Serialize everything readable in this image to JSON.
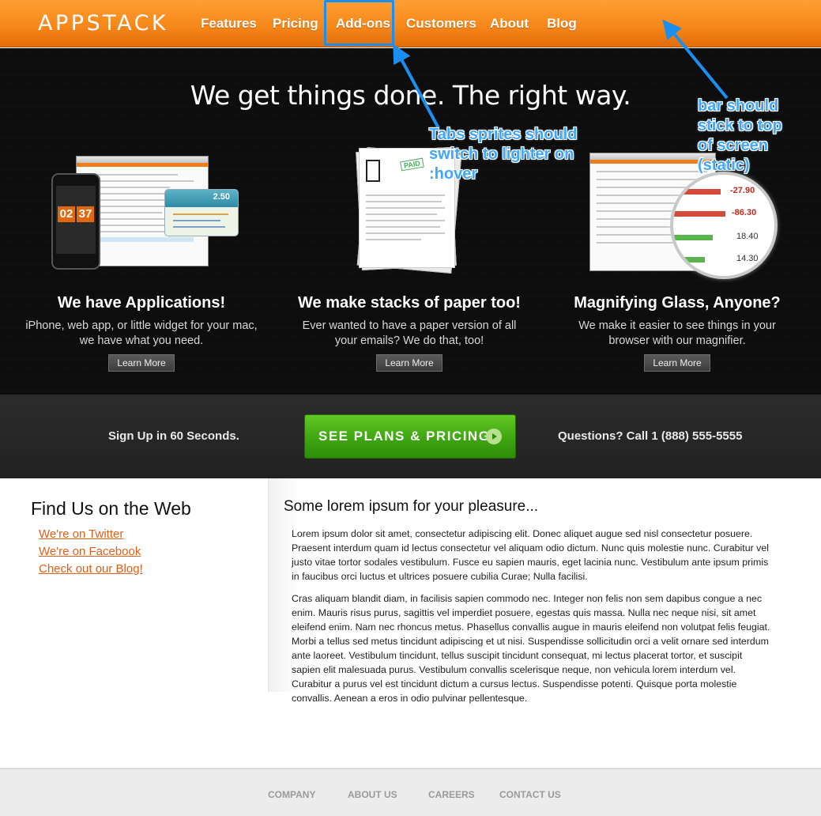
{
  "brand": {
    "logo": "APPSTACK",
    "accent": "#f7881a",
    "cta_green": "#3fa512"
  },
  "nav": {
    "items": [
      {
        "label": "Features"
      },
      {
        "label": "Pricing"
      },
      {
        "label": "Add-ons"
      },
      {
        "label": "Customers"
      },
      {
        "label": "About"
      },
      {
        "label": "Blog"
      }
    ]
  },
  "hero": {
    "headline": "We get things done. The right way.",
    "features": [
      {
        "title": "We have Applications!",
        "description": "iPhone, web app, or little widget for your mac, we have what you need.",
        "button": "Learn More"
      },
      {
        "title": "We make stacks of paper too!",
        "description": "Ever wanted to have a paper version of all your emails? We do that, too!",
        "button": "Learn More"
      },
      {
        "title": "Magnifying Glass, Anyone?",
        "description": "We make it easier to see things in your browser with our magnifier.",
        "button": "Learn More"
      }
    ],
    "widget": {
      "price": "2.50",
      "clock_hours": "02",
      "clock_minutes": "37"
    },
    "magnifier_values": [
      "-27.90",
      "-86.30",
      "18.40",
      "14.30"
    ],
    "paper_stamp": "PAID"
  },
  "annotations": {
    "tabs_note": [
      "Tabs sprites should",
      "switch to lighter on",
      ":hover"
    ],
    "bar_note": [
      "bar should",
      "stick to top",
      "of screen",
      "(static)"
    ],
    "color": "#40a6ff"
  },
  "cta": {
    "left": "Sign Up in 60 Seconds.",
    "button": "SEE PLANS & PRICING",
    "right": "Questions? Call 1 (888) 555-5555"
  },
  "sidebar": {
    "title": "Find Us on the Web",
    "links": [
      "We're on Twitter",
      "We're on Facebook",
      "Check out our Blog!"
    ]
  },
  "main": {
    "title": "Some lorem ipsum for your pleasure...",
    "paragraphs": [
      "Lorem ipsum dolor sit amet, consectetur adipiscing elit. Donec aliquet augue sed nisl consectetur posuere. Praesent interdum quam id lectus consectetur vel aliquam odio dictum. Nunc quis molestie nunc. Curabitur vel justo vitae tortor sodales vestibulum. Fusce eu sapien mauris, eget lacinia nunc. Vestibulum ante ipsum primis in faucibus orci luctus et ultrices posuere cubilia Curae; Nulla facilisi.",
      "Cras aliquam blandit diam, in facilisis sapien commodo nec. Integer non felis non sem dapibus congue a nec enim. Mauris risus purus, sagittis vel imperdiet posuere, egestas quis massa. Nulla nec neque nisi, sit amet eleifend enim. Nam nec rhoncus metus. Phasellus convallis augue in mauris eleifend non volutpat felis feugiat. Morbi a tellus sed metus tincidunt adipiscing et ut nisi. Suspendisse sollicitudin orci a velit ornare sed interdum ante laoreet. Vestibulum tincidunt, tellus suscipit tincidunt consequat, mi lectus placerat tortor, et suscipit sapien elit malesuada purus. Vestibulum convallis scelerisque neque, non vehicula lorem interdum vel. Curabitur a purus vel est tincidunt dictum a cursus lectus. Suspendisse potenti. Quisque porta molestie convallis. Aenean a eros in odio pulvinar pellentesque."
    ]
  },
  "footer": {
    "links": [
      "COMPANY",
      "ABOUT US",
      "CAREERS",
      "CONTACT US"
    ]
  }
}
